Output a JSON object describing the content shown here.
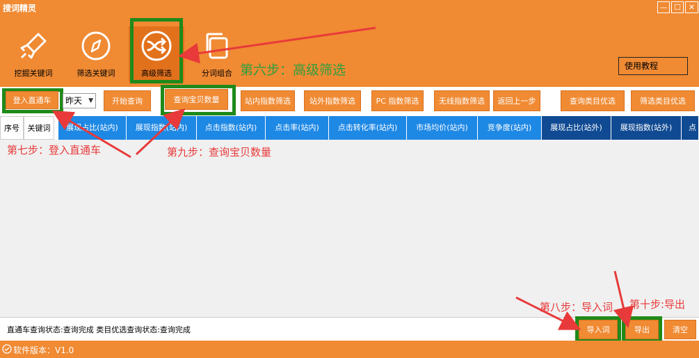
{
  "window": {
    "title": "搜词精灵",
    "minimize": "—",
    "maximize": "☐",
    "close": "✕"
  },
  "toolbar": {
    "tools": [
      {
        "label": "挖掘关键词",
        "icon": "rocket-icon"
      },
      {
        "label": "筛选关键词",
        "icon": "compass-icon"
      },
      {
        "label": "高级筛选",
        "icon": "shuffle-icon"
      },
      {
        "label": "分词组合",
        "icon": "copy-icon"
      }
    ],
    "help_label": "使用教程"
  },
  "buttons": {
    "login": "登入直通车",
    "day_select": "昨天",
    "start_query": "开始查询",
    "query_count": "查询宝贝数量",
    "filter_in_site": "站内指数筛选",
    "filter_out_site": "站外指数筛选",
    "filter_pc": "PC  指数筛选",
    "filter_wireless": "无线指数筛选",
    "back": "返回上一步",
    "category_query": "查询类目优选",
    "category_filter": "筛选类目优选",
    "import_words": "导入词",
    "export": "导出",
    "clear": "清空"
  },
  "grid": {
    "columns": [
      "序号",
      "关键词",
      "展现占比(站内)",
      "展现指数(站内)",
      "点击指数(站内)",
      "点击率(站内)",
      "点击转化率(站内)",
      "市场均价(站内)",
      "竞争度(站内)",
      "展现占比(站外)",
      "展现指数(站外)",
      "点"
    ]
  },
  "status": {
    "text": "直通车查询状态:查询完成    类目优选查询状态:查询完成"
  },
  "footer": {
    "version": "软件版本：V1.0"
  },
  "annotations": {
    "step6": "第六步：高级筛选",
    "step7": "第七步：登入直通车",
    "step8": "第八步：导入词",
    "step9": "第九步：查询宝贝数量",
    "step10": "第十步:导出"
  },
  "colors": {
    "orange": "#f08a33",
    "green_frame": "#1f8a1a",
    "blue_header": "#1e88e5",
    "navy_header": "#104a93",
    "annotation_red": "#e83a3a",
    "annotation_green": "#2f9e3d"
  }
}
